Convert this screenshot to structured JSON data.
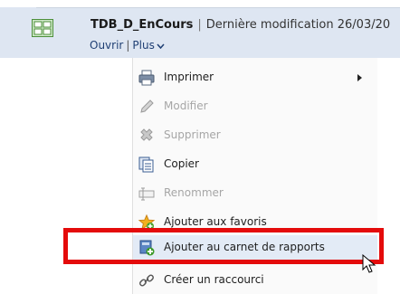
{
  "item": {
    "name": "TDB_D_EnCours",
    "meta": "Dernière modification 26/03/20",
    "icon": "dashboard-grid-icon"
  },
  "links": {
    "open": "Ouvrir",
    "more": "Plus"
  },
  "menu": {
    "items": [
      {
        "label": "Imprimer",
        "icon": "printer-icon",
        "disabled": false,
        "submenu": true
      },
      {
        "label": "Modifier",
        "icon": "pencil-icon",
        "disabled": true
      },
      {
        "label": "Supprimer",
        "icon": "delete-x-icon",
        "disabled": true
      },
      {
        "label": "Copier",
        "icon": "copy-icon",
        "disabled": false
      },
      {
        "label": "Renommer",
        "icon": "rename-icon",
        "disabled": true
      },
      {
        "label": "Ajouter aux favoris",
        "icon": "favorites-star-icon",
        "disabled": false
      },
      {
        "label": "Ajouter au carnet de rapports",
        "icon": "add-to-briefing-book-icon",
        "disabled": false,
        "highlighted": true
      },
      {
        "label": "Créer un raccourci",
        "icon": "shortcut-icon",
        "disabled": false
      }
    ]
  },
  "colors": {
    "highlight": "#e40b0b",
    "row_bg": "#dee6f2",
    "link": "#1f3f74"
  }
}
